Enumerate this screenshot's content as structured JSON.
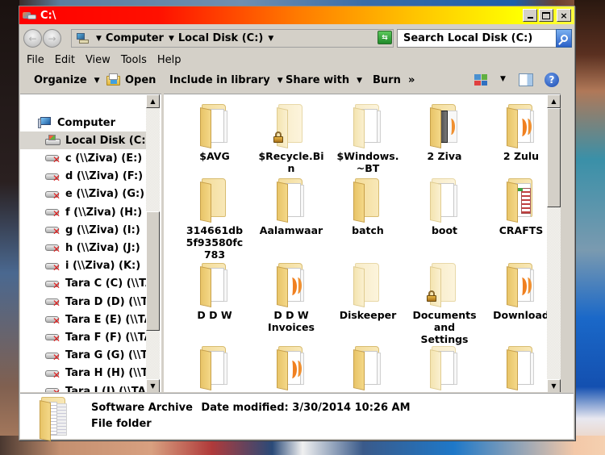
{
  "window": {
    "title": "C:\\",
    "controls": {
      "minimize": "minimize",
      "maximize": "maximize",
      "close": "×"
    }
  },
  "address_bar": {
    "breadcrumbs": [
      "Computer",
      "Local Disk (C:)"
    ],
    "refresh_icon": "refresh-icon",
    "search_placeholder": "Search Local Disk (C:)"
  },
  "menu": [
    "File",
    "Edit",
    "View",
    "Tools",
    "Help"
  ],
  "toolbar": {
    "organize": "Organize",
    "open": "Open",
    "include_in_library": "Include in library",
    "share_with": "Share with",
    "burn": "Burn",
    "more": "»",
    "caret": "▼"
  },
  "navigation": {
    "items": [
      {
        "label": "Computer",
        "icon": "computer-icon",
        "selected": false
      },
      {
        "label": "Local Disk (C:)",
        "icon": "local-disk-icon",
        "selected": true
      },
      {
        "label": "c (\\\\Ziva) (E:)",
        "icon": "disconnected-network-drive-icon"
      },
      {
        "label": "d (\\\\Ziva) (F:)",
        "icon": "disconnected-network-drive-icon"
      },
      {
        "label": "e (\\\\Ziva) (G:)",
        "icon": "disconnected-network-drive-icon"
      },
      {
        "label": "f (\\\\Ziva) (H:)",
        "icon": "disconnected-network-drive-icon"
      },
      {
        "label": "g (\\\\Ziva) (I:)",
        "icon": "disconnected-network-drive-icon"
      },
      {
        "label": "h (\\\\Ziva) (J:)",
        "icon": "disconnected-network-drive-icon"
      },
      {
        "label": "i (\\\\Ziva) (K:)",
        "icon": "disconnected-network-drive-icon"
      },
      {
        "label": "Tara C (C) (\\\\TARA",
        "icon": "disconnected-network-drive-icon"
      },
      {
        "label": "Tara D (D) (\\\\TARA",
        "icon": "disconnected-network-drive-icon"
      },
      {
        "label": "Tara E (E) (\\\\TARA",
        "icon": "disconnected-network-drive-icon"
      },
      {
        "label": "Tara F (F) (\\\\TARA",
        "icon": "disconnected-network-drive-icon"
      },
      {
        "label": "Tara G (G) (\\\\TARA",
        "icon": "disconnected-network-drive-icon"
      },
      {
        "label": "Tara H (H) (\\\\TARA",
        "icon": "disconnected-network-drive-icon"
      },
      {
        "label": "Tara I (I) (\\\\TARA",
        "icon": "disconnected-network-drive-icon"
      }
    ]
  },
  "files": [
    {
      "name": "$AVG",
      "variant": "pages",
      "locked": false
    },
    {
      "name": "$Recycle.Bin",
      "display": "$Recycle.Bi\nn",
      "variant": "pale",
      "locked": true
    },
    {
      "name": "$Windows.~BT",
      "display": "$Windows.\n~BT",
      "variant": "pale-pages",
      "locked": false
    },
    {
      "name": "2 Ziva",
      "variant": "dark",
      "locked": false
    },
    {
      "name": "2 Zulu",
      "variant": "orange",
      "locked": false
    },
    {
      "name": "314661db5f93580fc783",
      "display": "314661db\n5f93580fc\n783",
      "variant": "plain",
      "locked": false
    },
    {
      "name": "Aalamwaar",
      "variant": "pages",
      "locked": false
    },
    {
      "name": "batch",
      "variant": "plain",
      "locked": false
    },
    {
      "name": "boot",
      "variant": "pale-pages",
      "locked": false
    },
    {
      "name": "CRAFTS",
      "variant": "crafts",
      "locked": false
    },
    {
      "name": "D D W",
      "variant": "pages",
      "locked": false
    },
    {
      "name": "D D W Invoices",
      "display": "D D W\nInvoices",
      "variant": "orange",
      "locked": false
    },
    {
      "name": "Diskeeper",
      "variant": "pale",
      "locked": false
    },
    {
      "name": "Documents and Settings",
      "display": "Documents\nand\nSettings",
      "variant": "pale",
      "locked": true
    },
    {
      "name": "Download",
      "variant": "orange",
      "locked": false
    },
    {
      "name": "",
      "variant": "pages",
      "locked": false
    },
    {
      "name": "",
      "variant": "orange",
      "locked": false
    },
    {
      "name": "",
      "variant": "pages",
      "locked": false
    },
    {
      "name": "",
      "variant": "pale-pages",
      "locked": false
    },
    {
      "name": "",
      "variant": "pages",
      "locked": false
    }
  ],
  "details": {
    "name": "Software Archive",
    "date_label": "Date modified:",
    "date_value": "3/30/2014 10:26 AM",
    "type": "File folder"
  }
}
